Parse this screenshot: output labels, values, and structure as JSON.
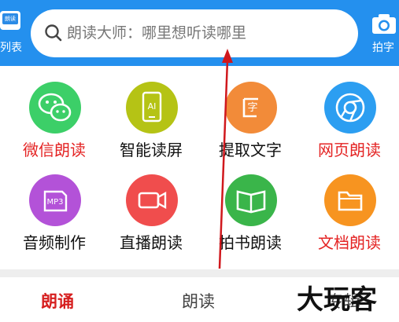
{
  "header": {
    "left_button": {
      "icon_text": "朗读",
      "label": "列表",
      "icon": "list-book-icon"
    },
    "search": {
      "placeholder": "朗读大师：哪里想听读哪里",
      "icon": "search-icon"
    },
    "right_button": {
      "label": "拍字",
      "icon": "camera-icon"
    }
  },
  "features": [
    {
      "label": "微信朗读",
      "icon": "wechat-icon",
      "color": "#3ccf68",
      "label_color": "#e42323"
    },
    {
      "label": "智能读屏",
      "icon": "ai-phone-icon",
      "color": "#b5c315",
      "label_color": "#111111"
    },
    {
      "label": "提取文字",
      "icon": "extract-text-icon",
      "color": "#f28b39",
      "label_color": "#111111"
    },
    {
      "label": "网页朗读",
      "icon": "browser-icon",
      "color": "#2c9ef1",
      "label_color": "#e42323"
    },
    {
      "label": "音频制作",
      "icon": "mp3-icon",
      "color": "#b352d8",
      "label_color": "#111111"
    },
    {
      "label": "直播朗读",
      "icon": "video-camera-icon",
      "color": "#f04d4d",
      "label_color": "#111111"
    },
    {
      "label": "拍书朗读",
      "icon": "book-icon",
      "color": "#3ab54a",
      "label_color": "#111111"
    },
    {
      "label": "文档朗读",
      "icon": "folder-icon",
      "color": "#f79420",
      "label_color": "#e42323"
    }
  ],
  "bottom_tabs": [
    {
      "label": "朗诵",
      "active": true
    },
    {
      "label": "朗读",
      "active": false
    },
    {
      "label": "专辑",
      "active": false
    }
  ],
  "watermark": {
    "text": "大玩客"
  },
  "colors": {
    "header_bg": "#2490ee",
    "annotation_arrow": "#d0181d",
    "active_tab": "#d61f1f"
  }
}
